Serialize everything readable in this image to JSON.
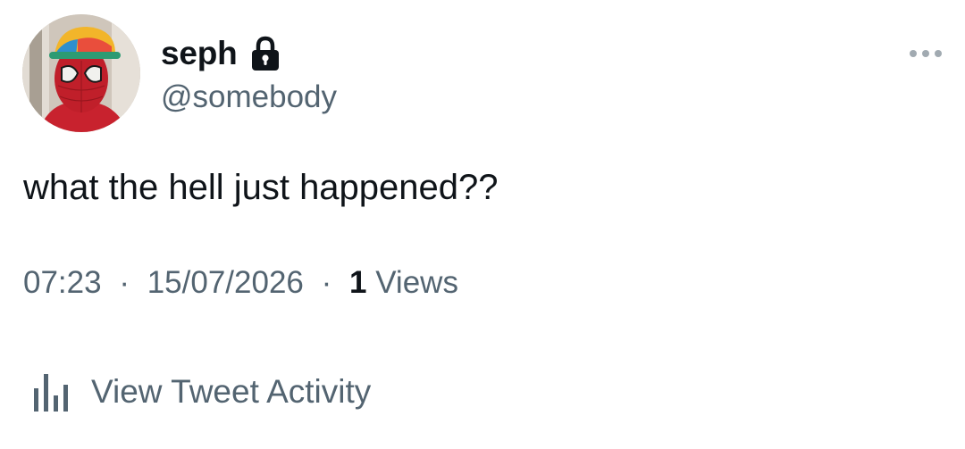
{
  "user": {
    "display_name": "seph",
    "handle": "@somebody",
    "locked": true
  },
  "tweet": {
    "text": "what the hell just happened??"
  },
  "meta": {
    "time": "07:23",
    "separator": "·",
    "date": "15/07/2026",
    "views_count": "1",
    "views_label": "Views"
  },
  "actions": {
    "view_activity_label": "View Tweet Activity"
  },
  "icons": {
    "avatar": "spiderman-avatar",
    "lock": "lock-icon",
    "more": "more-icon",
    "activity": "bar-chart-icon"
  },
  "colors": {
    "text_primary": "#0f1419",
    "text_secondary": "#536471",
    "background": "#ffffff"
  }
}
